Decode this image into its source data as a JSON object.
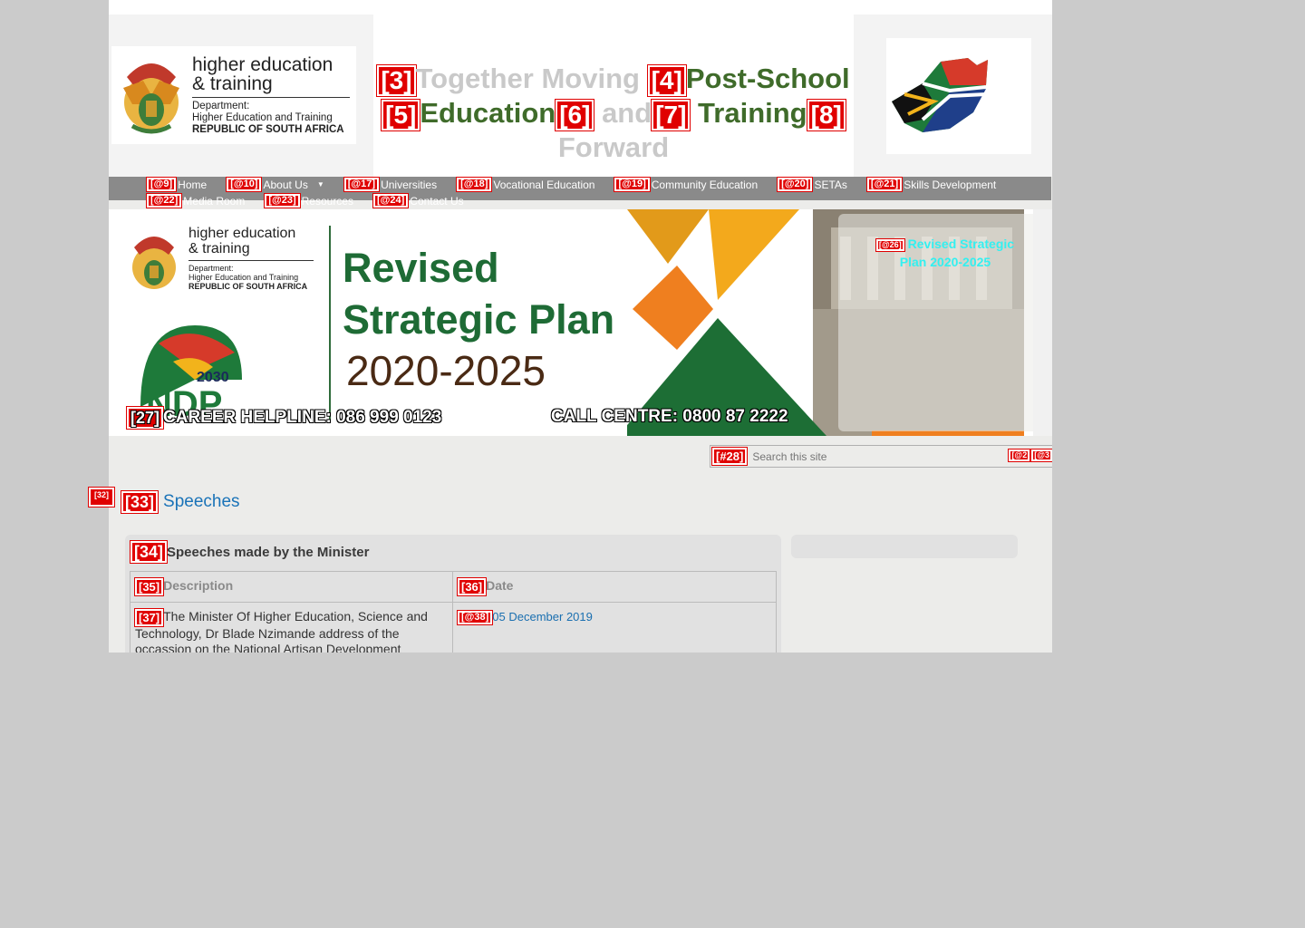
{
  "header": {
    "logo": {
      "title_line1": "higher education",
      "title_line2": "& training",
      "sub_line1": "Department:",
      "sub_line2": "Higher Education and Training",
      "sub_line3": "REPUBLIC OF SOUTH AFRICA"
    },
    "slogan": {
      "tag3": "[3]",
      "word1": "Together Moving",
      "tag4": "[4]",
      "word2": "Post-School",
      "tag5": "[5]",
      "word3": "Education",
      "tag6": "[6]",
      "word4": "and",
      "tag7": "[7]",
      "word5": "Training",
      "tag8": "[8]",
      "word6": "Forward"
    }
  },
  "nav": {
    "items": [
      {
        "tag": "[@9]",
        "label": "Home"
      },
      {
        "tag": "[@10]",
        "label": "About Us"
      },
      {
        "tag": "[@17]",
        "label": "Universities"
      },
      {
        "tag": "[@18]",
        "label": "Vocational Education"
      },
      {
        "tag": "[@19]",
        "label": "Community Education"
      },
      {
        "tag": "[@20]",
        "label": "SETAs"
      },
      {
        "tag": "[@21]",
        "label": "Skills Development"
      },
      {
        "tag": "[@22]",
        "label": "Media Room"
      },
      {
        "tag": "[@23]",
        "label": "Resources"
      },
      {
        "tag": "[@24]",
        "label": "Contact Us"
      }
    ]
  },
  "banner": {
    "logo_title1": "higher education",
    "logo_title2": "& training",
    "logo_sub1": "Department:",
    "logo_sub2": "Higher Education and Training",
    "logo_sub3": "REPUBLIC OF SOUTH AFRICA",
    "headline1": "Revised",
    "headline2": "Strategic Plan",
    "years": "2020-2025",
    "ndp_year": "2030",
    "ndp_text": "NDP",
    "helpline_tag": "[27]",
    "helpline": "CAREER HELPLINE: 086 999 0123",
    "call_centre": "CALL CENTRE: 0800 87 2222",
    "link_tag": "[@26]",
    "link_line1": "Revised Strategic",
    "link_line2": "Plan 2020-2025"
  },
  "search": {
    "tag": "[#28]",
    "placeholder": "Search this site",
    "btn1_tag": "[@2",
    "btn2_tag": "[@3"
  },
  "main": {
    "side_tag": "[32]",
    "title_tag": "[33]",
    "title": "Speeches",
    "card_tag": "[34]",
    "card_title": "Speeches made by the Minister",
    "table": {
      "headers": [
        {
          "tag": "[35]",
          "label": "Description"
        },
        {
          "tag": "[36]",
          "label": "Date"
        }
      ],
      "rows": [
        {
          "desc_tag": "[37]",
          "description": "The Minister Of Higher Education, Science and Technology, Dr Blade Nzimande address of the occassion on the National  Artisan Development",
          "date_tag": "[@38]",
          "date": "05 December 2019"
        }
      ]
    }
  },
  "colors": {
    "page_bg": "#cbcbcb",
    "nav_bg": "#8a8a8a",
    "slogan_green": "#3f6b2a",
    "slogan_grey": "#c9c9c9",
    "link_blue": "#1a73b8",
    "tag_red": "#e00000"
  }
}
